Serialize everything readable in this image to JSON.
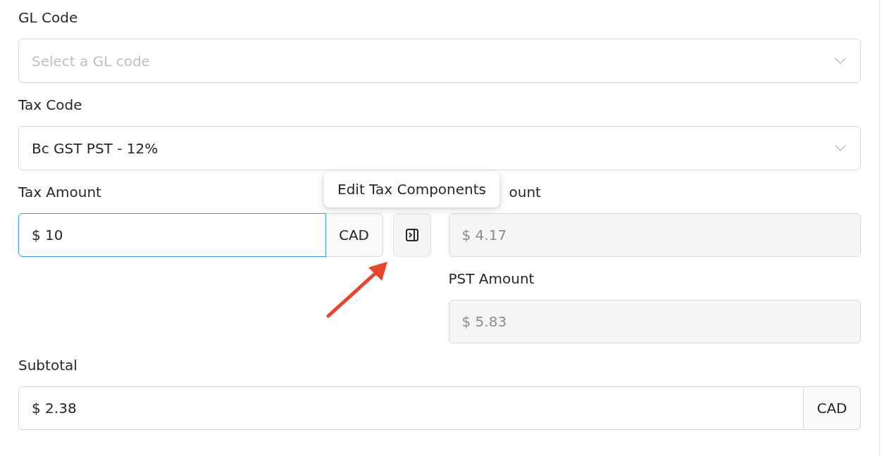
{
  "selects": [
    {
      "label": "GL Code",
      "placeholder": "Select a GL code"
    },
    {
      "label": "Tax Code",
      "value": "Bc GST PST - 12%"
    }
  ],
  "tax_amount": {
    "label": "Tax Amount",
    "value": "$ 10",
    "currency": "CAD",
    "focused": true,
    "edit_button": {
      "tooltip": "Edit Tax Components"
    }
  },
  "tax_components": [
    {
      "label": "ount",
      "value": "$ 4.17",
      "disabled": true
    },
    {
      "label": "PST Amount",
      "value": "$ 5.83",
      "disabled": true
    }
  ],
  "subtotal": {
    "label": "Subtotal",
    "value": "$ 2.38",
    "currency": "CAD",
    "focused": false
  }
}
